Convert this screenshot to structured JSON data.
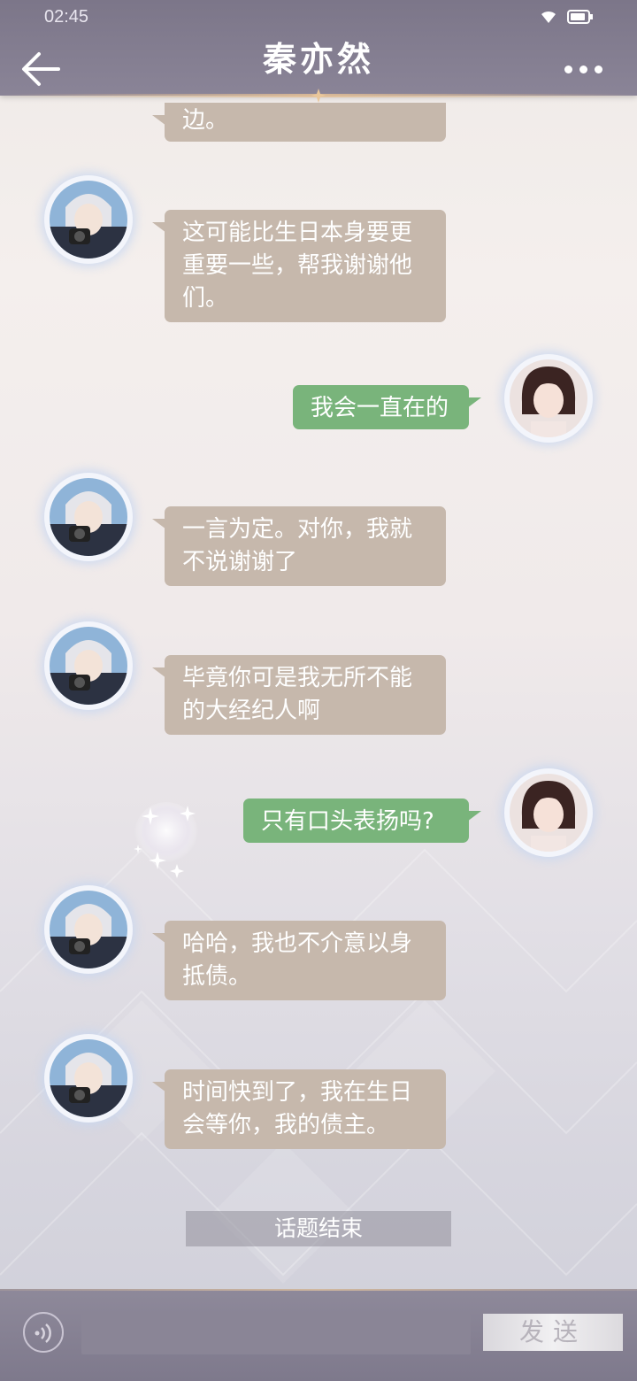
{
  "status_bar": {
    "time": "02:45"
  },
  "header": {
    "title": "秦亦然"
  },
  "messages": [
    {
      "side": "in",
      "lines": [
        "边。"
      ]
    },
    {
      "side": "in",
      "lines": [
        "这可能比生日本身要更",
        "重要一些，帮我谢谢他",
        "们。"
      ]
    },
    {
      "side": "out",
      "lines": [
        "我会一直在的"
      ]
    },
    {
      "side": "in",
      "lines": [
        "一言为定。对你，我就",
        "不说谢谢了"
      ]
    },
    {
      "side": "in",
      "lines": [
        "毕竟你可是我无所不能",
        "的大经纪人啊"
      ]
    },
    {
      "side": "out",
      "lines": [
        "只有口头表扬吗?"
      ]
    },
    {
      "side": "in",
      "lines": [
        "哈哈，我也不介意以身",
        "抵债。"
      ]
    },
    {
      "side": "in",
      "lines": [
        "时间快到了，我在生日",
        "会等你，我的债主。"
      ]
    }
  ],
  "topic_end": "话题结束",
  "input": {
    "value": "",
    "send_label": "发送"
  },
  "colors": {
    "header": "#817b8f",
    "incoming_bubble": "#c6b8ac",
    "outgoing_bubble": "#79b47b",
    "avatar_glow": "#c8d7f0"
  },
  "icons": {
    "back": "back-arrow-icon",
    "more": "more-dots-icon",
    "voice": "voice-icon",
    "wifi": "wifi-icon",
    "battery": "battery-icon"
  }
}
